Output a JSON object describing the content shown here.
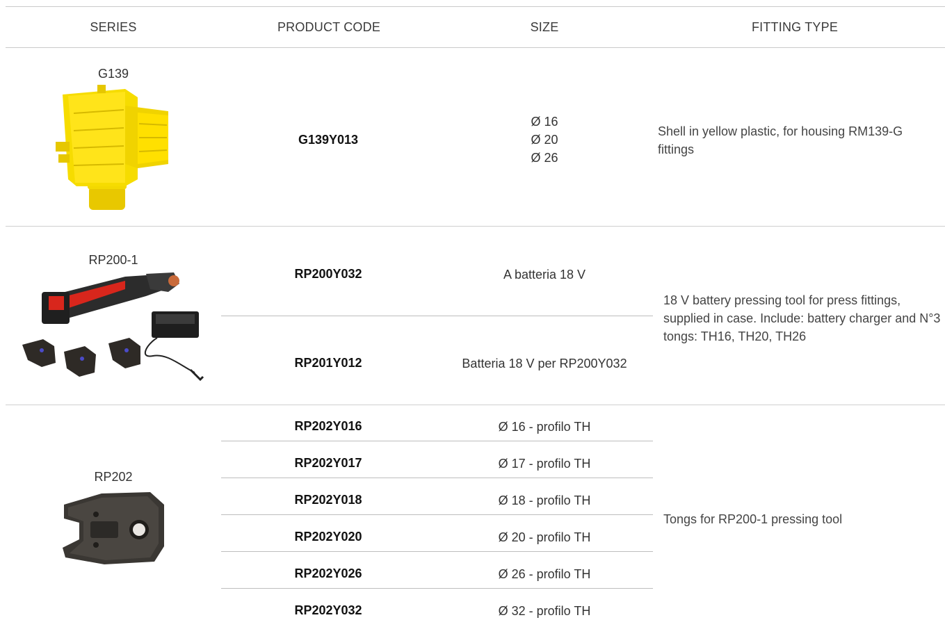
{
  "table": {
    "headers": {
      "series": "SERIES",
      "product_code": "PRODUCT CODE",
      "size": "SIZE",
      "fitting_type": "FITTING TYPE"
    },
    "groups": [
      {
        "series": "G139",
        "image_icon": "yellow-plastic-shell-image",
        "rows": [
          {
            "code": "G139Y013",
            "size_lines": [
              "Ø 16",
              "Ø 20",
              "Ø 26"
            ]
          }
        ],
        "fitting_type": "Shell in yellow plastic, for housing RM139-G fittings"
      },
      {
        "series": "RP200-1",
        "image_icon": "battery-pressing-tool-kit-image",
        "rows": [
          {
            "code": "RP200Y032",
            "size": "A batteria 18 V"
          },
          {
            "code": "RP201Y012",
            "size": "Batteria 18 V per RP200Y032"
          }
        ],
        "fitting_type": "18 V battery pressing tool for press fittings, supplied in case. Include: battery charger and N°3 tongs: TH16, TH20, TH26"
      },
      {
        "series": "RP202",
        "image_icon": "pressing-tong-jaw-image",
        "rows": [
          {
            "code": "RP202Y016",
            "size": "Ø 16 - profilo TH"
          },
          {
            "code": "RP202Y017",
            "size": "Ø 17 - profilo TH"
          },
          {
            "code": "RP202Y018",
            "size": "Ø 18 - profilo TH"
          },
          {
            "code": "RP202Y020",
            "size": "Ø 20 - profilo TH"
          },
          {
            "code": "RP202Y026",
            "size": "Ø 26 - profilo TH"
          },
          {
            "code": "RP202Y032",
            "size": "Ø 32 - profilo TH"
          }
        ],
        "fitting_type": "Tongs for RP200-1 pressing tool"
      }
    ]
  },
  "colors": {
    "yellow_plastic": "#f3d800",
    "tool_red": "#d8261c",
    "tool_dark": "#2a2a2a",
    "divider": "#cfcfcf"
  }
}
